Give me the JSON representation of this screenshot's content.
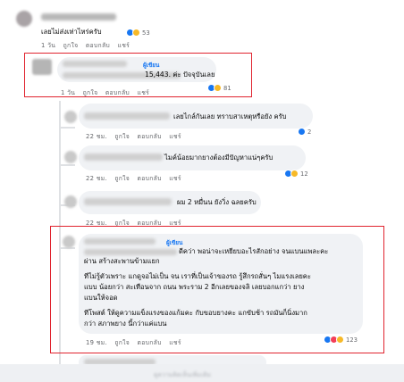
{
  "comments": [
    {
      "text": "เลยไม่ส่งเท่าไหร่ครับ",
      "time": "1 วัน",
      "like": "ถูกใจ",
      "reply": "ตอบกลับ",
      "share": "แชร์",
      "count": "53"
    },
    {
      "badge": "ผู้เขียน",
      "text": "15,443. ค่ะ ปัจจุบันเลย",
      "time": "1 วัน",
      "like": "ถูกใจ",
      "reply": "ตอบกลับ",
      "share": "แชร์",
      "count": "81"
    },
    {
      "text": "เลยไกล์กันเลย ทราบสาเหตุหรือยัง ครับ",
      "time": "22 ชม.",
      "like": "ถูกใจ",
      "reply": "ตอบกลับ",
      "share": "แชร์",
      "count": "2"
    },
    {
      "text": "ไมค์น้อยมากยางต้องมีปัญหาแน่ๆครับ",
      "time": "22 ชม.",
      "like": "ถูกใจ",
      "reply": "ตอบกลับ",
      "share": "แชร์",
      "count": "12"
    },
    {
      "text": "ผม 2 หมื่นน ยังวิ่ง ฉลยครับ",
      "time": "22 ชม.",
      "like": "ถูกใจ",
      "reply": "ตอบกลับ",
      "share": "แชร์"
    },
    {
      "badge": "ผู้เขียน",
      "lines": [
        "ดีคว่า พอน่าจะเหยียบอะไรสักอย่าง จนแบนแพละคะ",
        "ผ่าน สร้างสะพานข้ามแยก",
        "ทีไม่รู้ตัวเพราะ แกดูจอไม่เป็น จน เราที่เป็นเจ้าของรถ รู้สึกรถสั่นๆ ไมแรงเลยคะ",
        "แบบ น้อยกว่า สะเทือนจาก ถนน พระราม 2 อีกเลยของจลิ เลยบอกแกว่า ยาง",
        "แบนให้จอด",
        "ทีโพสต์ ให้ดูความแข็งแรงของแก้มคะ กับขอบยางคะ แกขับช้า รถมันก็นิ่งมาก",
        "กว่า สภาพยาง นี้กว่าแค่แบน"
      ],
      "time": "19 ชม.",
      "like": "ถูกใจ",
      "reply": "ตอบกลับ",
      "share": "แชร์",
      "count": "123"
    }
  ],
  "footer": {
    "hint": "ดูความคิดเห็นเพิ่มเติม"
  }
}
